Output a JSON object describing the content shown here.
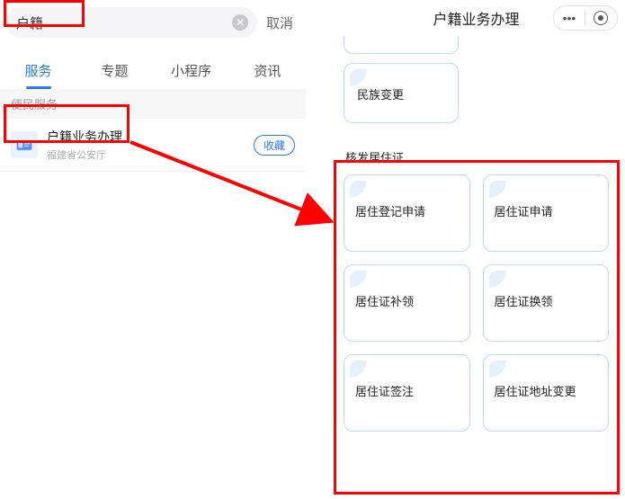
{
  "left": {
    "search_value": "户籍",
    "cancel": "取消",
    "tabs": [
      "服务",
      "专题",
      "小程序",
      "资讯"
    ],
    "active_tab_index": 0,
    "section_head": "便民服务",
    "result": {
      "title": "户籍业务办理",
      "subtitle": "福建省公安厅",
      "fav": "收藏"
    }
  },
  "right": {
    "title": "户籍业务办理",
    "top_card": "民族变更",
    "section_title": "核发居住证",
    "cards": [
      "居住登记申请",
      "居住证申请",
      "居住证补领",
      "居住证换领",
      "居住证签注",
      "居住证地址变更"
    ]
  }
}
